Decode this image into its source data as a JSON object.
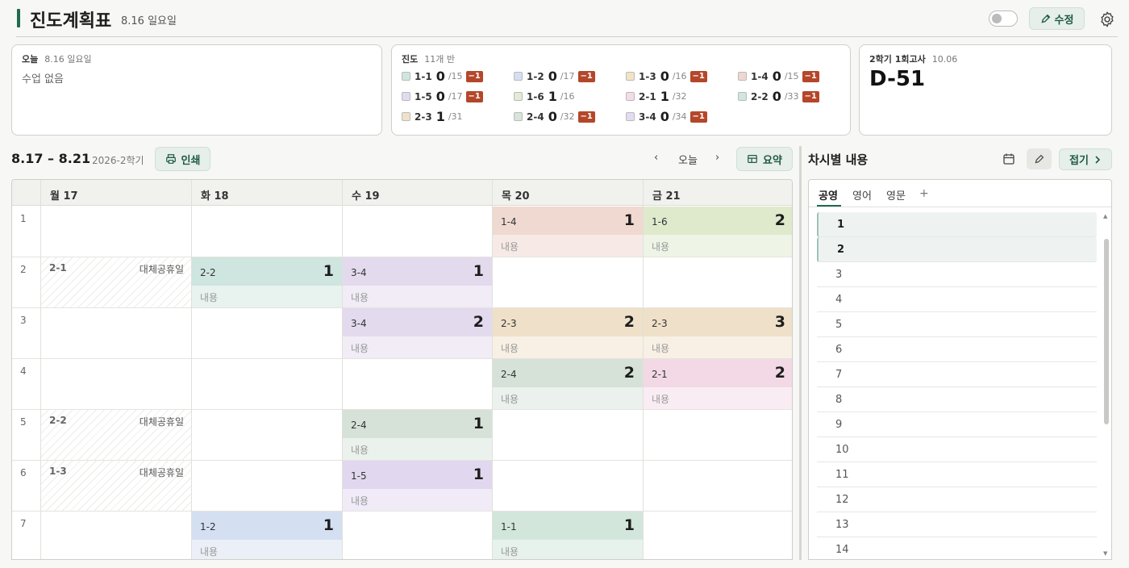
{
  "header": {
    "title": "진도계획표",
    "date": "8.16 일요일",
    "edit_label": "수정"
  },
  "cards": {
    "today": {
      "label": "오늘",
      "date": "8.16 일요일",
      "message": "수업 없음"
    },
    "progress": {
      "label": "진도",
      "subtitle": "11개 반",
      "items": [
        {
          "cls": "1-1",
          "count": "0",
          "total": "/15",
          "badge": "−1",
          "color": "#cfe6df"
        },
        {
          "cls": "1-2",
          "count": "0",
          "total": "/17",
          "badge": "−1",
          "color": "#d6def2"
        },
        {
          "cls": "1-3",
          "count": "0",
          "total": "/16",
          "badge": "−1",
          "color": "#f2e3c6"
        },
        {
          "cls": "1-4",
          "count": "0",
          "total": "/15",
          "badge": "−1",
          "color": "#f0d7cf"
        },
        {
          "cls": "1-5",
          "count": "0",
          "total": "/17",
          "badge": "−1",
          "color": "#e2daf0"
        },
        {
          "cls": "1-6",
          "count": "1",
          "total": "/16",
          "badge": "",
          "color": "#e1ecd3"
        },
        {
          "cls": "2-1",
          "count": "1",
          "total": "/32",
          "badge": "",
          "color": "#f4dbe8"
        },
        {
          "cls": "2-2",
          "count": "0",
          "total": "/33",
          "badge": "−1",
          "color": "#cfe6e2"
        },
        {
          "cls": "2-3",
          "count": "1",
          "total": "/31",
          "badge": "",
          "color": "#f0e1c9"
        },
        {
          "cls": "2-4",
          "count": "0",
          "total": "/32",
          "badge": "−1",
          "color": "#d7e4da"
        },
        {
          "cls": "3-4",
          "count": "0",
          "total": "/34",
          "badge": "−1",
          "color": "#e3dbf1"
        }
      ]
    },
    "exam": {
      "label": "2학기 1회고사",
      "date": "10.06",
      "dday": "D-51"
    }
  },
  "week": {
    "range": "8.17 – 8.21",
    "semester": "2026-2학기",
    "print_label": "인쇄",
    "prev": "‹",
    "today_label": "오늘",
    "next": "›",
    "summary_label": "요약"
  },
  "days": [
    "월 17",
    "화 18",
    "수 19",
    "목 20",
    "금 21"
  ],
  "periods": [
    "1",
    "2",
    "3",
    "4",
    "5",
    "6",
    "7"
  ],
  "holidays": [
    {
      "day": 0,
      "period": 1,
      "cls": "2-1",
      "label": "대체공휴일"
    },
    {
      "day": 0,
      "period": 4,
      "cls": "2-2",
      "label": "대체공휴일"
    },
    {
      "day": 0,
      "period": 5,
      "cls": "1-3",
      "label": "대체공휴일"
    }
  ],
  "lessons": [
    {
      "day": 3,
      "period": 0,
      "cls": "1-4",
      "num": "1",
      "content": "내용",
      "top": "#f0d9d0",
      "bottom": "#f7eae6"
    },
    {
      "day": 4,
      "period": 0,
      "cls": "1-6",
      "num": "2",
      "content": "내용",
      "top": "#dfeacd",
      "bottom": "#eef4e6"
    },
    {
      "day": 1,
      "period": 1,
      "cls": "2-2",
      "num": "1",
      "content": "내용",
      "top": "#cfe5df",
      "bottom": "#e8f2ef"
    },
    {
      "day": 2,
      "period": 1,
      "cls": "3-4",
      "num": "1",
      "content": "내용",
      "top": "#e3daee",
      "bottom": "#f1ecf6"
    },
    {
      "day": 2,
      "period": 2,
      "cls": "3-4",
      "num": "2",
      "content": "내용",
      "top": "#e3daee",
      "bottom": "#f1ecf6"
    },
    {
      "day": 3,
      "period": 2,
      "cls": "2-3",
      "num": "2",
      "content": "내용",
      "top": "#efe0c9",
      "bottom": "#f8f0e4"
    },
    {
      "day": 4,
      "period": 2,
      "cls": "2-3",
      "num": "3",
      "content": "내용",
      "top": "#efe0c9",
      "bottom": "#f8f0e4"
    },
    {
      "day": 3,
      "period": 3,
      "cls": "2-4",
      "num": "2",
      "content": "내용",
      "top": "#d6e2d8",
      "bottom": "#ebf1ec"
    },
    {
      "day": 4,
      "period": 3,
      "cls": "2-1",
      "num": "2",
      "content": "내용",
      "top": "#f2d9e5",
      "bottom": "#f9edf3"
    },
    {
      "day": 2,
      "period": 4,
      "cls": "2-4",
      "num": "1",
      "content": "내용",
      "top": "#d6e2d8",
      "bottom": "#ebf1ec"
    },
    {
      "day": 2,
      "period": 5,
      "cls": "1-5",
      "num": "1",
      "content": "내용",
      "top": "#e1d8ef",
      "bottom": "#f0ebf7"
    },
    {
      "day": 1,
      "period": 6,
      "cls": "1-2",
      "num": "1",
      "content": "내용",
      "top": "#d4dff2",
      "bottom": "#ebf0f8"
    },
    {
      "day": 3,
      "period": 6,
      "cls": "1-1",
      "num": "1",
      "content": "내용",
      "top": "#d2e6dc",
      "bottom": "#e8f2ec"
    }
  ],
  "side": {
    "title": "차시별 내용",
    "fold_label": "접기",
    "tabs": [
      "공영",
      "영어",
      "영문"
    ],
    "add_tab": "+",
    "rows": [
      "1",
      "2",
      "3",
      "4",
      "5",
      "6",
      "7",
      "8",
      "9",
      "10",
      "11",
      "12",
      "13",
      "14"
    ],
    "selected_rows": [
      "1",
      "2"
    ]
  }
}
